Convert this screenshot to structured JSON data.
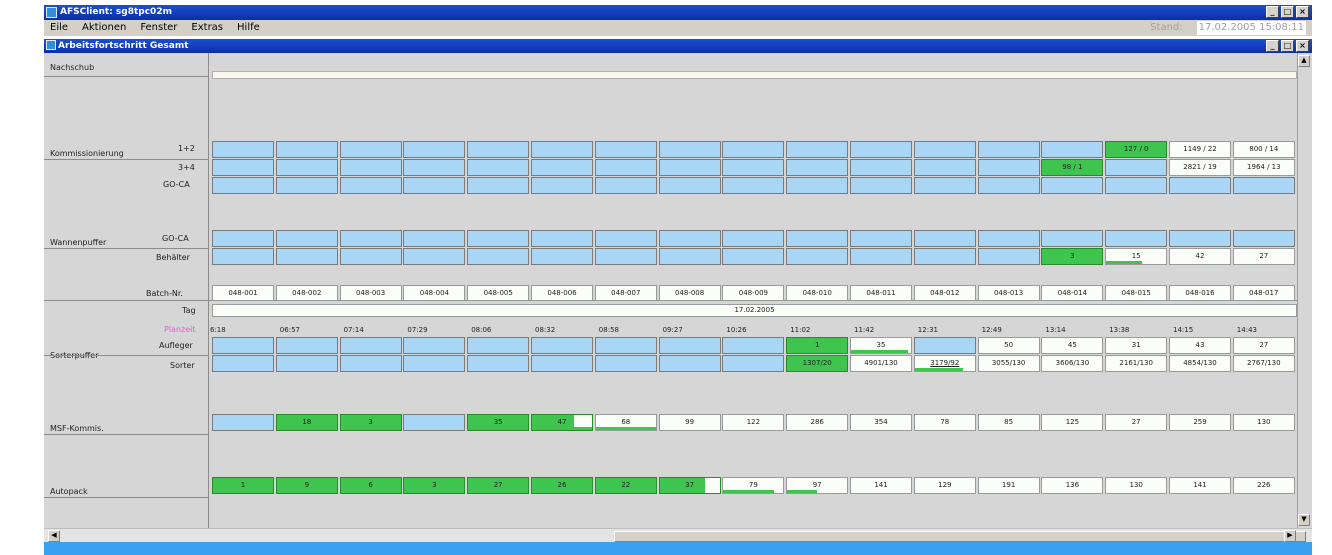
{
  "outer_title": "AFSClient: sg8tpc02m",
  "menu": [
    "Eile",
    "Aktionen",
    "Fenster",
    "Extras",
    "Hilfe"
  ],
  "stand": {
    "label": "Stand:",
    "value": "17.02.2005 15:08:11"
  },
  "inner_title": "Arbeitsfortschritt Gesamt",
  "window_controls": {
    "min": "_",
    "max": "□",
    "close": "×"
  },
  "labels": {
    "nachschub": "Nachschub",
    "kommissionierung": "Kommissionierung",
    "k_1_2": "1+2",
    "k_3_4": "3+4",
    "k_goca": "GO-CA",
    "wannenpuffer": "Wannenpuffer",
    "w_goca": "GO-CA",
    "w_behaelter": "Behälter",
    "batch_nr": "Batch-Nr.",
    "tag": "Tag",
    "planzeit": "Planzeit",
    "sorterpuffer": "Sorterpuffer",
    "aufleger": "Aufleger",
    "sorter": "Sorter",
    "msf": "MSF-Kommis.",
    "autopack": "Autopack"
  },
  "tag_value": "17.02.2005",
  "time_labels": [
    "6:18",
    "06:57",
    "07:14",
    "07:29",
    "08:06",
    "08:32",
    "08:58",
    "09:27",
    "10:26",
    "11:02",
    "11:42",
    "12:31",
    "12:49",
    "13:14",
    "13:38",
    "14:15",
    "14:43"
  ],
  "batches": [
    "048-001",
    "048-002",
    "048-003",
    "048-004",
    "048-005",
    "048-006",
    "048-007",
    "048-008",
    "048-009",
    "048-010",
    "048-011",
    "048-012",
    "048-013",
    "048-014",
    "048-015",
    "048-016",
    "048-017"
  ],
  "rows": {
    "k12": [
      {
        "type": "blue",
        "text": ""
      },
      {
        "type": "blue",
        "text": ""
      },
      {
        "type": "blue",
        "text": ""
      },
      {
        "type": "blue",
        "text": ""
      },
      {
        "type": "blue",
        "text": ""
      },
      {
        "type": "blue",
        "text": ""
      },
      {
        "type": "blue",
        "text": ""
      },
      {
        "type": "blue",
        "text": ""
      },
      {
        "type": "blue",
        "text": ""
      },
      {
        "type": "blue",
        "text": ""
      },
      {
        "type": "blue",
        "text": ""
      },
      {
        "type": "blue",
        "text": ""
      },
      {
        "type": "blue",
        "text": ""
      },
      {
        "type": "blue",
        "text": ""
      },
      {
        "type": "green",
        "text": "127 / 0"
      },
      {
        "type": "white",
        "text": "1149 / 22"
      },
      {
        "type": "white",
        "text": "800 / 14"
      }
    ],
    "k34": [
      {
        "type": "blue",
        "text": ""
      },
      {
        "type": "blue",
        "text": ""
      },
      {
        "type": "blue",
        "text": ""
      },
      {
        "type": "blue",
        "text": ""
      },
      {
        "type": "blue",
        "text": ""
      },
      {
        "type": "blue",
        "text": ""
      },
      {
        "type": "blue",
        "text": ""
      },
      {
        "type": "blue",
        "text": ""
      },
      {
        "type": "blue",
        "text": ""
      },
      {
        "type": "blue",
        "text": ""
      },
      {
        "type": "blue",
        "text": ""
      },
      {
        "type": "blue",
        "text": ""
      },
      {
        "type": "blue",
        "text": ""
      },
      {
        "type": "green",
        "text": "98 / 1"
      },
      {
        "type": "blue",
        "text": ""
      },
      {
        "type": "white",
        "text": "2821 / 19"
      },
      {
        "type": "white",
        "text": "1964 / 13"
      }
    ],
    "kgoca": [
      {
        "type": "blue",
        "text": ""
      },
      {
        "type": "blue",
        "text": ""
      },
      {
        "type": "blue",
        "text": ""
      },
      {
        "type": "blue",
        "text": ""
      },
      {
        "type": "blue",
        "text": ""
      },
      {
        "type": "blue",
        "text": ""
      },
      {
        "type": "blue",
        "text": ""
      },
      {
        "type": "blue",
        "text": ""
      },
      {
        "type": "blue",
        "text": ""
      },
      {
        "type": "blue",
        "text": ""
      },
      {
        "type": "blue",
        "text": ""
      },
      {
        "type": "blue",
        "text": ""
      },
      {
        "type": "blue",
        "text": ""
      },
      {
        "type": "blue",
        "text": ""
      },
      {
        "type": "blue",
        "text": ""
      },
      {
        "type": "blue",
        "text": ""
      },
      {
        "type": "blue",
        "text": ""
      }
    ],
    "wgoca": [
      {
        "type": "blue",
        "text": ""
      },
      {
        "type": "blue",
        "text": ""
      },
      {
        "type": "blue",
        "text": ""
      },
      {
        "type": "blue",
        "text": ""
      },
      {
        "type": "blue",
        "text": ""
      },
      {
        "type": "blue",
        "text": ""
      },
      {
        "type": "blue",
        "text": ""
      },
      {
        "type": "blue",
        "text": ""
      },
      {
        "type": "blue",
        "text": ""
      },
      {
        "type": "blue",
        "text": ""
      },
      {
        "type": "blue",
        "text": ""
      },
      {
        "type": "blue",
        "text": ""
      },
      {
        "type": "blue",
        "text": ""
      },
      {
        "type": "blue",
        "text": ""
      },
      {
        "type": "blue",
        "text": ""
      },
      {
        "type": "blue",
        "text": ""
      },
      {
        "type": "blue",
        "text": ""
      }
    ],
    "wbeh": [
      {
        "type": "blue",
        "text": ""
      },
      {
        "type": "blue",
        "text": ""
      },
      {
        "type": "blue",
        "text": ""
      },
      {
        "type": "blue",
        "text": ""
      },
      {
        "type": "blue",
        "text": ""
      },
      {
        "type": "blue",
        "text": ""
      },
      {
        "type": "blue",
        "text": ""
      },
      {
        "type": "blue",
        "text": ""
      },
      {
        "type": "blue",
        "text": ""
      },
      {
        "type": "blue",
        "text": ""
      },
      {
        "type": "blue",
        "text": ""
      },
      {
        "type": "blue",
        "text": ""
      },
      {
        "type": "blue",
        "text": ""
      },
      {
        "type": "green",
        "text": "3"
      },
      {
        "type": "white",
        "text": "15",
        "bar": 0.6
      },
      {
        "type": "white",
        "text": "42"
      },
      {
        "type": "white",
        "text": "27"
      }
    ],
    "auf": [
      {
        "type": "blue",
        "text": ""
      },
      {
        "type": "blue",
        "text": ""
      },
      {
        "type": "blue",
        "text": ""
      },
      {
        "type": "blue",
        "text": ""
      },
      {
        "type": "blue",
        "text": ""
      },
      {
        "type": "blue",
        "text": ""
      },
      {
        "type": "blue",
        "text": ""
      },
      {
        "type": "blue",
        "text": ""
      },
      {
        "type": "blue",
        "text": ""
      },
      {
        "type": "green",
        "text": "1"
      },
      {
        "type": "white",
        "text": "35",
        "bar": 0.95
      },
      {
        "type": "blue",
        "text": ""
      },
      {
        "type": "white",
        "text": "50"
      },
      {
        "type": "white",
        "text": "45"
      },
      {
        "type": "white",
        "text": "31"
      },
      {
        "type": "white",
        "text": "43"
      },
      {
        "type": "white",
        "text": "27"
      }
    ],
    "sor": [
      {
        "type": "blue",
        "text": ""
      },
      {
        "type": "blue",
        "text": ""
      },
      {
        "type": "blue",
        "text": ""
      },
      {
        "type": "blue",
        "text": ""
      },
      {
        "type": "blue",
        "text": ""
      },
      {
        "type": "blue",
        "text": ""
      },
      {
        "type": "blue",
        "text": ""
      },
      {
        "type": "blue",
        "text": ""
      },
      {
        "type": "blue",
        "text": ""
      },
      {
        "type": "green",
        "text": "1307/20"
      },
      {
        "type": "white",
        "text": "4901/130"
      },
      {
        "type": "white",
        "text": "3179/92",
        "bar": 0.8,
        "underline": true
      },
      {
        "type": "white",
        "text": "3055/130"
      },
      {
        "type": "white",
        "text": "3606/130"
      },
      {
        "type": "white",
        "text": "2161/130"
      },
      {
        "type": "white",
        "text": "4854/130"
      },
      {
        "type": "white",
        "text": "2767/130"
      }
    ],
    "msf": [
      {
        "type": "blue",
        "text": ""
      },
      {
        "type": "green",
        "text": "18"
      },
      {
        "type": "green",
        "text": "3"
      },
      {
        "type": "blue",
        "text": ""
      },
      {
        "type": "green",
        "text": "35"
      },
      {
        "type": "green",
        "text": "47",
        "bar": 1.0,
        "mixed": 0.7
      },
      {
        "type": "white",
        "text": "68",
        "bar": 1.0
      },
      {
        "type": "white",
        "text": "99"
      },
      {
        "type": "white",
        "text": "122"
      },
      {
        "type": "white",
        "text": "286"
      },
      {
        "type": "white",
        "text": "354"
      },
      {
        "type": "white",
        "text": "78"
      },
      {
        "type": "white",
        "text": "85"
      },
      {
        "type": "white",
        "text": "125"
      },
      {
        "type": "white",
        "text": "27"
      },
      {
        "type": "white",
        "text": "259"
      },
      {
        "type": "white",
        "text": "130"
      }
    ],
    "aut": [
      {
        "type": "green",
        "text": "1"
      },
      {
        "type": "green",
        "text": "9"
      },
      {
        "type": "green",
        "text": "6"
      },
      {
        "type": "green",
        "text": "3"
      },
      {
        "type": "green",
        "text": "27"
      },
      {
        "type": "green",
        "text": "26"
      },
      {
        "type": "green",
        "text": "22"
      },
      {
        "type": "green",
        "text": "37",
        "mixed": 0.75
      },
      {
        "type": "white",
        "text": "79",
        "bar": 0.85
      },
      {
        "type": "white",
        "text": "97",
        "bar": 0.5
      },
      {
        "type": "white",
        "text": "141"
      },
      {
        "type": "white",
        "text": "129"
      },
      {
        "type": "white",
        "text": "191"
      },
      {
        "type": "white",
        "text": "136"
      },
      {
        "type": "white",
        "text": "130"
      },
      {
        "type": "white",
        "text": "141"
      },
      {
        "type": "white",
        "text": "226"
      }
    ]
  }
}
